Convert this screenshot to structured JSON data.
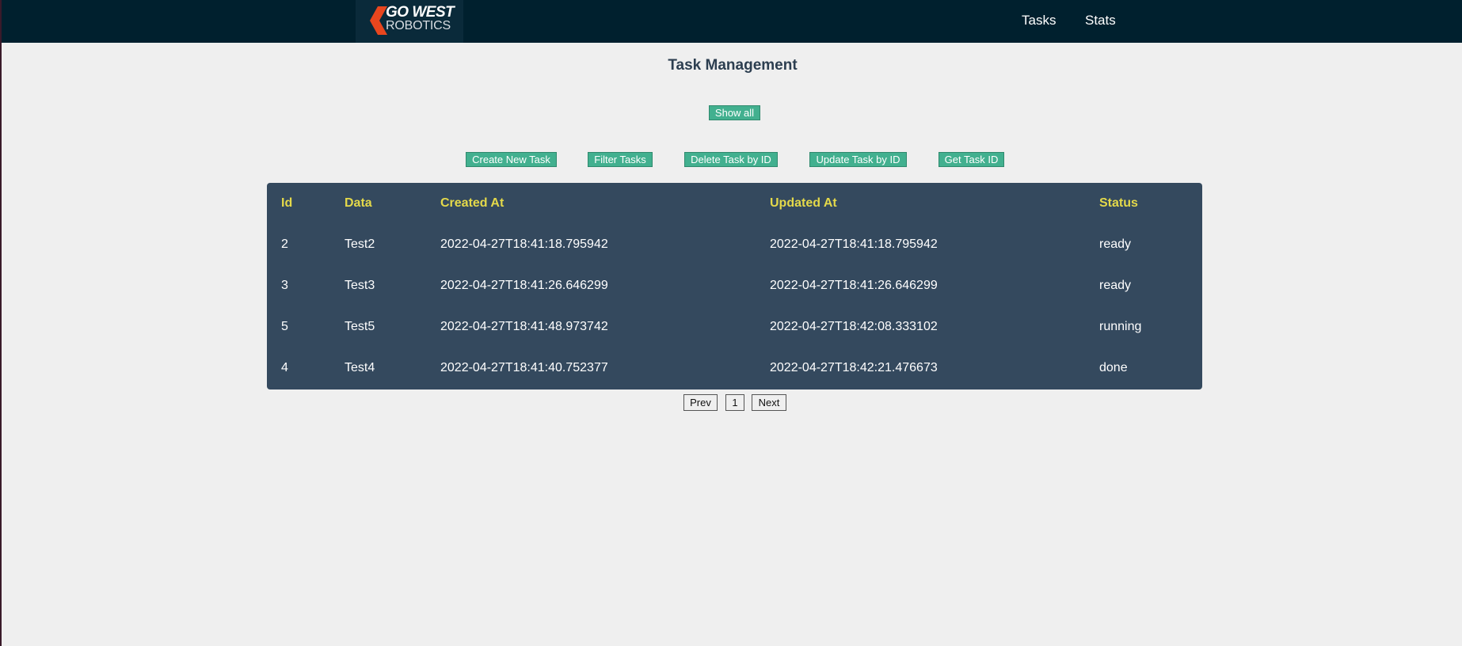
{
  "brand": {
    "logo_line1": "GO WEST",
    "logo_line2": "ROBOTICS",
    "accent": "#e8461e"
  },
  "nav": {
    "tasks": "Tasks",
    "stats": "Stats"
  },
  "page": {
    "title": "Task Management"
  },
  "actions": {
    "show_all": "Show all",
    "create": "Create New Task",
    "filter": "Filter Tasks",
    "delete": "Delete Task by ID",
    "update": "Update Task by ID",
    "get_id": "Get Task ID"
  },
  "table": {
    "headers": [
      "Id",
      "Data",
      "Created At",
      "Updated At",
      "Status"
    ],
    "rows": [
      [
        "2",
        "Test2",
        "2022-04-27T18:41:18.795942",
        "2022-04-27T18:41:18.795942",
        "ready"
      ],
      [
        "3",
        "Test3",
        "2022-04-27T18:41:26.646299",
        "2022-04-27T18:41:26.646299",
        "ready"
      ],
      [
        "5",
        "Test5",
        "2022-04-27T18:41:48.973742",
        "2022-04-27T18:42:08.333102",
        "running"
      ],
      [
        "4",
        "Test4",
        "2022-04-27T18:41:40.752377",
        "2022-04-27T18:42:21.476673",
        "done"
      ]
    ]
  },
  "pagination": {
    "prev": "Prev",
    "page": "1",
    "next": "Next"
  },
  "colors": {
    "topbar": "#00202e",
    "table_bg": "#34495e",
    "header_text": "#e4d94a",
    "button": "#42b08f"
  }
}
